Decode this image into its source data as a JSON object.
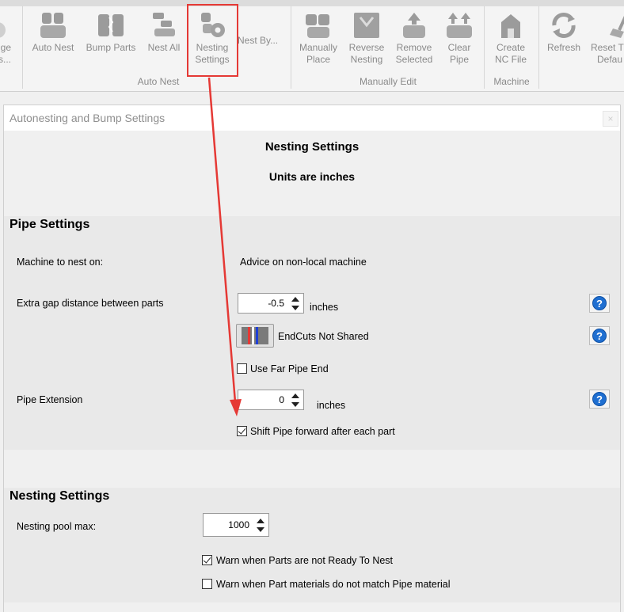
{
  "ribbon": {
    "partial_left_line1": "ge",
    "partial_left_line2": "s...",
    "buttons": [
      {
        "label": "Auto Nest"
      },
      {
        "label": "Bump Parts"
      },
      {
        "label": "Nest All"
      },
      {
        "label_line1": "Nesting",
        "label_line2": "Settings"
      },
      {
        "label": "Nest By..."
      },
      {
        "label_line1": "Manually",
        "label_line2": "Place"
      },
      {
        "label_line1": "Reverse",
        "label_line2": "Nesting"
      },
      {
        "label_line1": "Remove",
        "label_line2": "Selected"
      },
      {
        "label_line1": "Clear",
        "label_line2": "Pipe"
      },
      {
        "label_line1": "Create",
        "label_line2": "NC File"
      },
      {
        "label": "Refresh"
      },
      {
        "label_line1": "Reset T",
        "label_line2": "Defau"
      }
    ],
    "groups": {
      "auto_nest": "Auto Nest",
      "manually_edit": "Manually Edit",
      "machine": "Machine"
    },
    "accent": "#e53935"
  },
  "dialog": {
    "title": "Autonesting and Bump Settings",
    "close_glyph": "×",
    "header": {
      "title": "Nesting Settings",
      "units": "Units are inches"
    },
    "pipe_settings": {
      "title": "Pipe Settings",
      "machine_label": "Machine to nest on:",
      "machine_value": "Advice on non-local machine",
      "gap_label": "Extra gap distance between parts",
      "gap_value": "-0.5",
      "gap_unit": "inches",
      "endcuts_label": "EndCuts Not Shared",
      "far_end_label": "Use Far Pipe End",
      "far_end_checked": false,
      "extension_label": "Pipe Extension",
      "extension_value": "0",
      "extension_unit": "inches",
      "shift_label": "Shift Pipe forward after each part",
      "shift_checked": true
    },
    "nesting_settings": {
      "title": "Nesting Settings",
      "pool_label": "Nesting pool max:",
      "pool_value": "1000",
      "warn_ready_label": "Warn when Parts are not Ready To Nest",
      "warn_ready_checked": true,
      "warn_material_label": "Warn when Part materials do not match Pipe material",
      "warn_material_checked": false
    },
    "help_glyph": "?"
  }
}
